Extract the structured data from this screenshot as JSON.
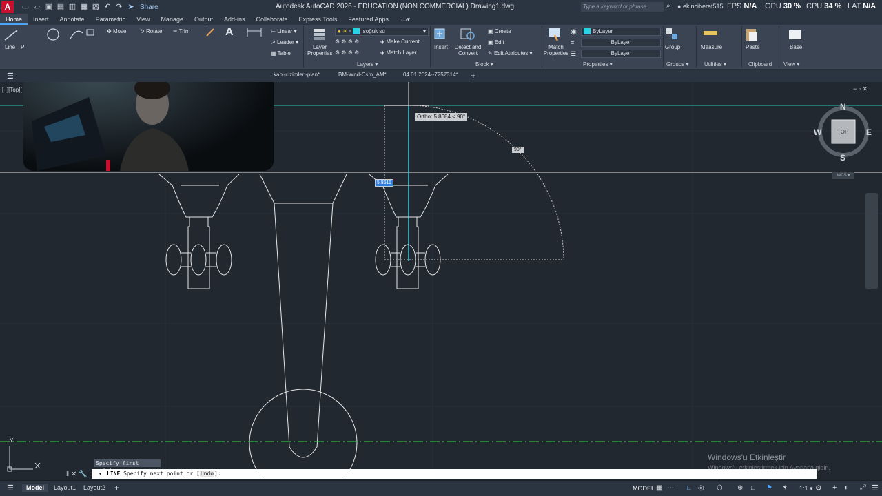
{
  "app": {
    "logo_letter": "A",
    "title": "Autodesk AutoCAD 2026 - EDUCATION (NON COMMERCIAL)   Drawing1.dwg",
    "share_label": "Share",
    "search_placeholder": "Type a keyword or phrase",
    "user": "ekinciberat515",
    "perf": {
      "fps_label": "FPS",
      "fps_value": "N/A",
      "gpu_label": "GPU",
      "gpu_value": "30 %",
      "cpu_label": "CPU",
      "cpu_value": "34 %",
      "lat_label": "LAT",
      "lat_value": "N/A"
    }
  },
  "ribbon_tabs": [
    "Home",
    "Insert",
    "Annotate",
    "Parametric",
    "View",
    "Manage",
    "Output",
    "Add-ins",
    "Collaborate",
    "Express Tools",
    "Featured Apps"
  ],
  "ribbon": {
    "draw": {
      "line": "Line",
      "poly": "P"
    },
    "modify": {
      "move": "Move",
      "rotate": "Rotate",
      "trim": "Trim"
    },
    "annotation": {
      "linear": "Linear",
      "leader": "Leader",
      "table": "Table"
    },
    "layers": {
      "layer_properties": "Layer\nProperties",
      "current_layer": "soğuk su",
      "make_current": "Make Current",
      "match_layer": "Match Layer",
      "title": "Layers"
    },
    "block": {
      "insert": "Insert",
      "detect_and_convert": "Detect and\nConvert",
      "create": "Create",
      "edit": "Edit",
      "edit_attributes": "Edit Attributes",
      "title": "Block"
    },
    "properties": {
      "match_properties": "Match\nProperties",
      "color": "ByLayer",
      "linetype": "ByLayer",
      "lineweight": "ByLayer",
      "title": "Properties"
    },
    "groups": {
      "group": "Group",
      "title": "Groups"
    },
    "utilities": {
      "measure": "Measure",
      "title": "Utilities"
    },
    "clipboard": {
      "paste": "Paste",
      "title": "Clipboard"
    },
    "view": {
      "base": "Base",
      "title": "View"
    }
  },
  "doc_tabs": [
    "kapi-cizimleri-plan*",
    "BM-Wnd-Csm_AM*",
    "04.01.2024--7257314*"
  ],
  "viewport": {
    "view_label": "[−][Top][",
    "ortho_tooltip": "Ortho: 5.8684 < 90°",
    "angle_tooltip": "90°",
    "dynamic_input": "5.8511",
    "compass": {
      "n": "N",
      "s": "S",
      "e": "E",
      "w": "W",
      "top": "TOP",
      "wcs": "WCS"
    },
    "ucs_y": "Y"
  },
  "command": {
    "prompt_tip": "Specify first point:",
    "line": "LINE",
    "text": " Specify next point or [",
    "option": "Undo",
    "tail": "]:"
  },
  "watermark": {
    "title": "Windows'u Etkinleştir",
    "subtitle": "Windows'u etkinleştirmek için Ayarlar'a gidin."
  },
  "status": {
    "layouts": [
      "Model",
      "Layout1",
      "Layout2"
    ],
    "model_label": "MODEL",
    "scale": "1:1"
  }
}
